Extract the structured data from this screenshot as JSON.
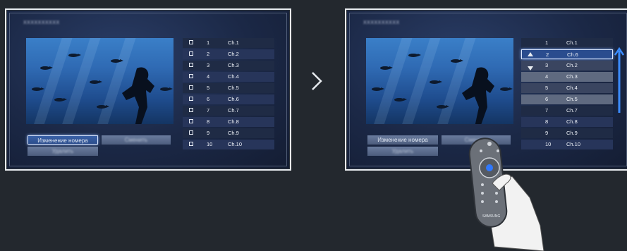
{
  "left_screen": {
    "header_text": "XXXXXXXXXX",
    "buttons": {
      "change_number": "Изменение номера",
      "secondary_1": "Сменить",
      "secondary_2": "Удалить"
    },
    "channels": [
      {
        "num": "1",
        "name": "Ch.1"
      },
      {
        "num": "2",
        "name": "Ch.2"
      },
      {
        "num": "3",
        "name": "Ch.3"
      },
      {
        "num": "4",
        "name": "Ch.4"
      },
      {
        "num": "5",
        "name": "Ch.5"
      },
      {
        "num": "6",
        "name": "Ch.6"
      },
      {
        "num": "7",
        "name": "Ch.7"
      },
      {
        "num": "8",
        "name": "Ch.8"
      },
      {
        "num": "9",
        "name": "Ch.9"
      },
      {
        "num": "10",
        "name": "Ch.10"
      }
    ]
  },
  "right_screen": {
    "header_text": "XXXXXXXXXX",
    "buttons": {
      "change_number": "Изменение номера",
      "secondary_1": "Сменить",
      "secondary_2": "Удалить"
    },
    "channels": [
      {
        "num": "1",
        "name": "Ch.1"
      },
      {
        "num": "2",
        "name": "Ch.6"
      },
      {
        "num": "3",
        "name": "Ch.2"
      },
      {
        "num": "4",
        "name": "Ch.3"
      },
      {
        "num": "5",
        "name": "Ch.4"
      },
      {
        "num": "6",
        "name": "Ch.5"
      },
      {
        "num": "7",
        "name": "Ch.7"
      },
      {
        "num": "8",
        "name": "Ch.8"
      },
      {
        "num": "9",
        "name": "Ch.9"
      },
      {
        "num": "10",
        "name": "Ch.10"
      }
    ]
  },
  "remote": {
    "brand": "SAMSUNG"
  },
  "icons": {
    "next": "chevron-right-icon",
    "move": "up-down-arrow-icon",
    "scroll": "up-arrow-icon"
  },
  "colors": {
    "background": "#23282e",
    "highlight": "#2a4c8e",
    "accent": "#8ab4ff"
  }
}
